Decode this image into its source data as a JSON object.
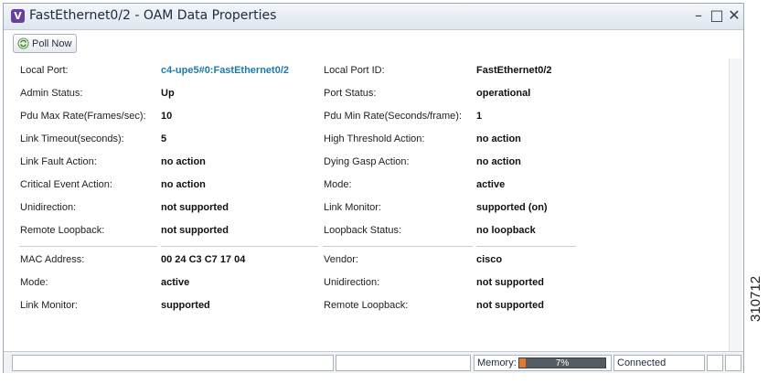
{
  "window": {
    "app_icon_letter": "V",
    "title": "FastEthernet0/2 - OAM Data Properties",
    "controls": {
      "minimize": "–",
      "maximize": "□",
      "close": "✕"
    }
  },
  "toolbar": {
    "poll_now_label": "Poll Now",
    "poll_icon": "refresh-icon"
  },
  "section1": {
    "rows": [
      {
        "left_label": "Local Port:",
        "left_value": "c4-upe5#0:FastEthernet0/2",
        "right_label": "Local Port ID:",
        "right_value": "FastEthernet0/2"
      },
      {
        "left_label": "Admin Status:",
        "left_value": "Up",
        "right_label": "Port Status:",
        "right_value": "operational"
      },
      {
        "left_label": "Pdu Max Rate(Frames/sec):",
        "left_value": "10",
        "right_label": "Pdu Min Rate(Seconds/frame):",
        "right_value": "1"
      },
      {
        "left_label": "Link Timeout(seconds):",
        "left_value": "5",
        "right_label": "High Threshold Action:",
        "right_value": "no action"
      },
      {
        "left_label": "Link Fault Action:",
        "left_value": "no action",
        "right_label": "Dying Gasp Action:",
        "right_value": "no action"
      },
      {
        "left_label": "Critical Event Action:",
        "left_value": "no action",
        "right_label": "Mode:",
        "right_value": "active"
      },
      {
        "left_label": "Unidirection:",
        "left_value": "not supported",
        "right_label": "Link Monitor:",
        "right_value": "supported (on)"
      },
      {
        "left_label": "Remote Loopback:",
        "left_value": "not supported",
        "right_label": "Loopback Status:",
        "right_value": "no loopback"
      }
    ]
  },
  "section2": {
    "rows": [
      {
        "left_label": "MAC Address:",
        "left_value": "00 24 C3 C7 17 04",
        "right_label": "Vendor:",
        "right_value": "cisco"
      },
      {
        "left_label": "Mode:",
        "left_value": "active",
        "right_label": "Unidirection:",
        "right_value": "not supported"
      },
      {
        "left_label": "Link Monitor:",
        "left_value": "supported",
        "right_label": "Remote Loopback:",
        "right_value": "not supported"
      }
    ]
  },
  "statusbar": {
    "memory_label": "Memory:",
    "memory_percent_text": "7%",
    "memory_fraction": 0.07,
    "connection": "Connected"
  },
  "figure_id": "310712",
  "colors": {
    "link": "#1f7aa8",
    "app_icon": "#6b3fa0",
    "memory_fill": "#e07a2e"
  }
}
